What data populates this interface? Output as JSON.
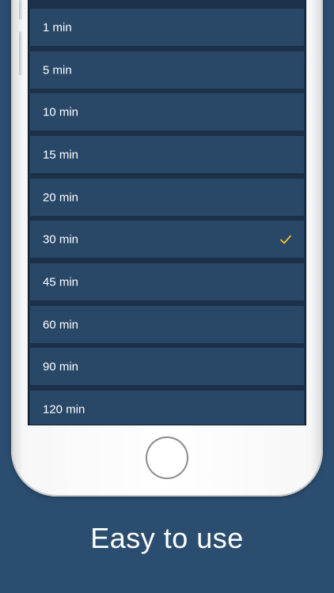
{
  "options": [
    {
      "label": "1 min",
      "selected": false
    },
    {
      "label": "5 min",
      "selected": false
    },
    {
      "label": "10 min",
      "selected": false
    },
    {
      "label": "15 min",
      "selected": false
    },
    {
      "label": "20 min",
      "selected": false
    },
    {
      "label": "30 min",
      "selected": true
    },
    {
      "label": "45 min",
      "selected": false
    },
    {
      "label": "60 min",
      "selected": false
    },
    {
      "label": "90 min",
      "selected": false
    },
    {
      "label": "120 min",
      "selected": false
    }
  ],
  "caption": "Easy to use",
  "colors": {
    "background": "#2b4e70",
    "row": "#294868",
    "checkmark": "#f2c230"
  },
  "icons": {
    "selected": "checkmark-icon",
    "home": "home-button"
  }
}
